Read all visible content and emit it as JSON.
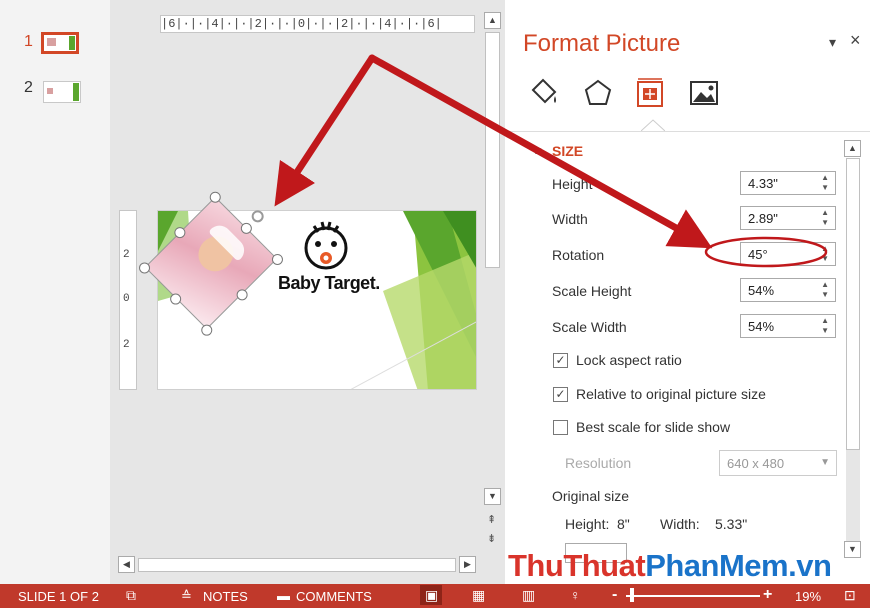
{
  "thumbnails": [
    {
      "number": "1",
      "selected": true
    },
    {
      "number": "2",
      "selected": false
    }
  ],
  "ruler": {
    "horizontal": "|6|·|·|4|·|·|2|·|·|0|·|·|2|·|·|4|·|·|6|",
    "vertical": [
      "2",
      "0",
      "2"
    ]
  },
  "slide": {
    "brand_text": "Baby Target."
  },
  "pane": {
    "title": "Format Picture",
    "dropdown_glyph": "▾",
    "close_glyph": "×",
    "tabs": [
      "fill-line-icon",
      "effects-icon",
      "size-properties-icon",
      "picture-icon"
    ],
    "section_title": "SIZE",
    "fields": [
      {
        "label": "Height",
        "value": "4.33\""
      },
      {
        "label": "Width",
        "value": "2.89\""
      },
      {
        "label": "Rotation",
        "value": "45°"
      },
      {
        "label": "Scale Height",
        "value": "54%"
      },
      {
        "label": "Scale Width",
        "value": "54%"
      }
    ],
    "checkboxes": [
      {
        "label": "Lock aspect ratio",
        "checked": true
      },
      {
        "label": "Relative to original picture size",
        "checked": true
      },
      {
        "label": "Best scale for slide show",
        "checked": false
      }
    ],
    "resolution_label": "Resolution",
    "resolution_value": "640 x 480",
    "original_size_label": "Original size",
    "original_height_label": "Height:",
    "original_height_value": "8\"",
    "original_width_label": "Width:",
    "original_width_value": "5.33\""
  },
  "statusbar": {
    "slide_info": "SLIDE 1 OF 2",
    "notes": "NOTES",
    "comments": "COMMENTS",
    "zoom_minus": "-",
    "zoom_plus": "+",
    "zoom": "19%"
  },
  "watermark": {
    "part1": "Thu",
    "part2": "Thuat",
    "part3": "PhanMem",
    "part4": ".vn"
  },
  "colors": {
    "accent": "#d24726",
    "status_bar": "#c0392b",
    "arrow": "#c0181b",
    "green": "#5aa62d"
  }
}
